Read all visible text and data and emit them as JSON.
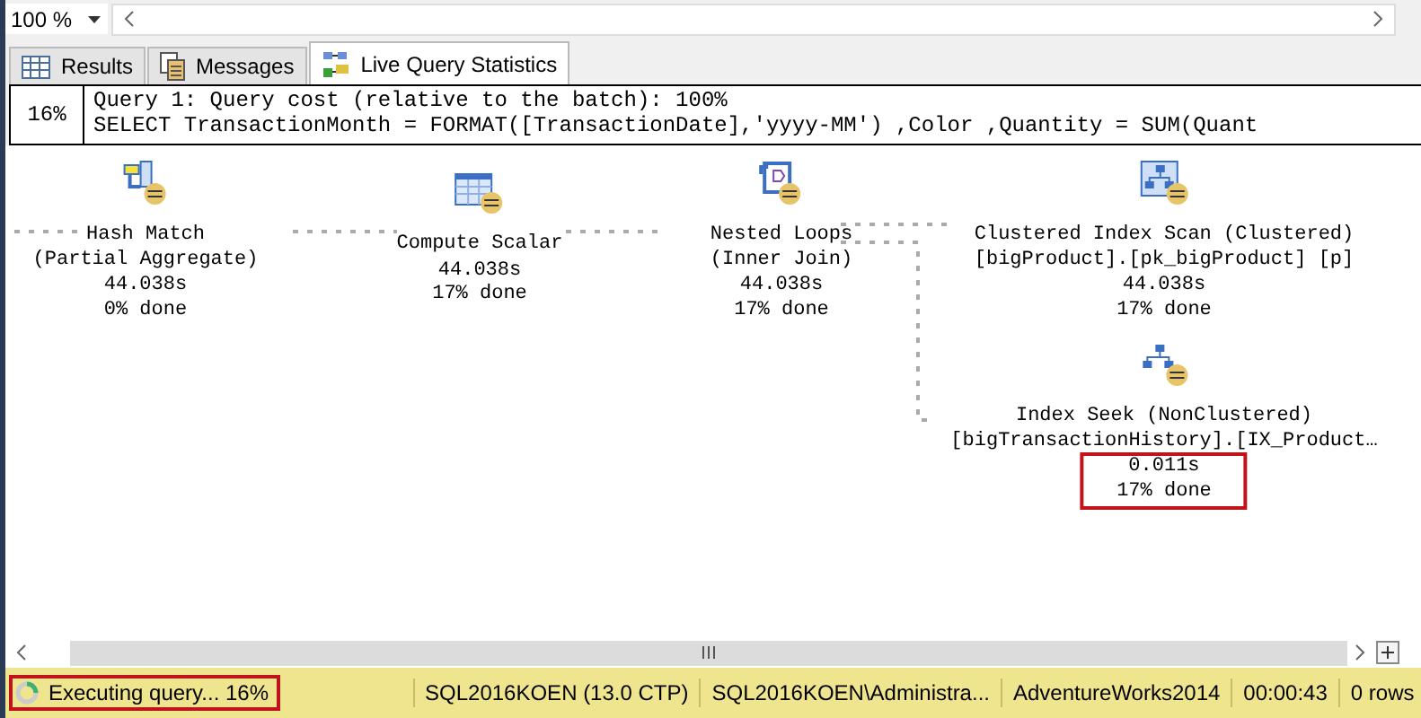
{
  "zoom": {
    "value": "100 %"
  },
  "tabs": [
    {
      "label": "Results",
      "kind": "grid",
      "selected": false
    },
    {
      "label": "Messages",
      "kind": "messages",
      "selected": false
    },
    {
      "label": "Live Query Statistics",
      "kind": "plan",
      "selected": true
    }
  ],
  "query": {
    "percent": "16%",
    "title": "Query 1: Query cost (relative to the batch): 100%",
    "sql": "SELECT TransactionMonth = FORMAT([TransactionDate],'yyyy-MM') ,Color ,Quantity = SUM(Quant"
  },
  "plan": {
    "nodes": [
      {
        "kind": "hash_match",
        "name": "Hash Match",
        "detail": "(Partial Aggregate)",
        "time": "44.038s",
        "progress": "0% done",
        "highlighted": false
      },
      {
        "kind": "compute_scalar",
        "name": "Compute Scalar",
        "time": "44.038s",
        "progress": "17% done",
        "highlighted": false
      },
      {
        "kind": "nested_loops",
        "name": "Nested Loops",
        "detail": "(Inner Join)",
        "time": "44.038s",
        "progress": "17% done",
        "highlighted": false
      },
      {
        "kind": "clustered_index_scan",
        "name": "Clustered Index Scan (Clustered)",
        "detail": "[bigProduct].[pk_bigProduct] [p]",
        "time": "44.038s",
        "progress": "17% done",
        "highlighted": false
      },
      {
        "kind": "index_seek",
        "name": "Index Seek (NonClustered)",
        "detail": "[bigTransactionHistory].[IX_Product…",
        "time": "0.011s",
        "progress": "17% done",
        "highlighted": true
      }
    ]
  },
  "status_bar": {
    "items": [
      {
        "kind": "progress",
        "text": "Executing query... 16%",
        "highlighted": true
      },
      {
        "kind": "text",
        "text": "SQL2016KOEN (13.0 CTP)",
        "highlighted": false
      },
      {
        "kind": "text",
        "text": "SQL2016KOEN\\Administra...",
        "highlighted": false
      },
      {
        "kind": "text",
        "text": "AdventureWorks2014",
        "highlighted": false
      },
      {
        "kind": "text",
        "text": "00:00:43",
        "highlighted": false
      },
      {
        "kind": "text",
        "text": "0 rows",
        "highlighted": false
      }
    ]
  }
}
